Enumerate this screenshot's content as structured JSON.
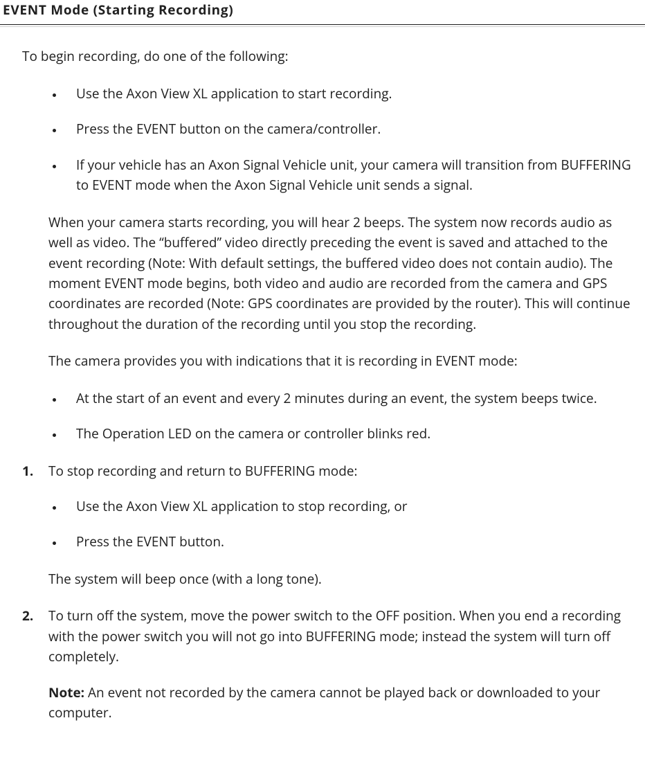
{
  "heading": "EVENT Mode (Starting Recording)",
  "intro": "To begin recording, do one of the following:",
  "startBullets": [
    "Use the Axon View XL application to start recording.",
    "Press the EVENT button on the camera/controller.",
    "If your vehicle has an Axon Signal Vehicle unit, your camera will transition from BUFFERING to EVENT mode when the Axon Signal Vehicle unit sends a signal."
  ],
  "explain1": "When your camera starts recording, you will hear 2 beeps. The system now records audio as well as video. The “buffered” video directly preceding the event is saved and attached to the event recording (Note: With default settings, the buffered video does not contain audio). The moment EVENT mode begins, both video and audio are recorded from the camera and GPS coordinates are recorded (Note: GPS coordinates are provided by the router). This will continue throughout the duration of the recording until you stop the recording.",
  "explain2": "The camera provides you with indications that it is recording in EVENT mode:",
  "indicatorBullets": [
    "At the start of an event and every 2 minutes during an event, the system beeps twice.",
    "The Operation LED on the camera or controller blinks red."
  ],
  "step1": {
    "lead": "To stop recording and return to BUFFERING mode:",
    "bullets": [
      "Use the Axon View XL application to stop recording, or",
      "Press the EVENT button."
    ],
    "after": "The system will beep once (with a long tone)."
  },
  "step2": {
    "lead": "To turn off the system, move the power switch to the OFF position. When you end a recording with the power switch you will not go into BUFFERING mode; instead the system will turn off completely.",
    "noteLabel": "Note:",
    "noteText": " An event not recorded by the camera cannot be played back or downloaded to your computer."
  }
}
